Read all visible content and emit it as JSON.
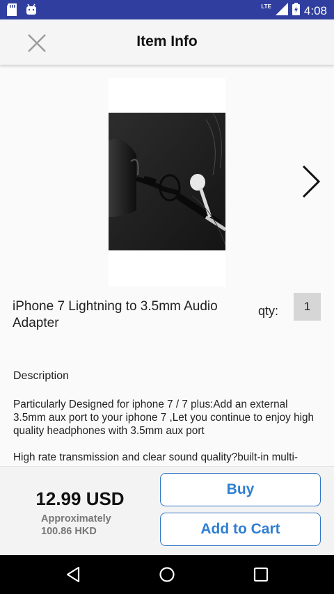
{
  "status_bar": {
    "time": "4:08",
    "network": "LTE",
    "icons": [
      "sd-card-icon",
      "android-icon",
      "signal-icon",
      "battery-icon"
    ]
  },
  "toolbar": {
    "title": "Item Info",
    "close_icon": "close-icon"
  },
  "product": {
    "name": "iPhone 7 Lightning to 3.5mm Audio Adapter",
    "qty_label": "qty:",
    "qty_value": "1",
    "next_icon": "chevron-right-icon"
  },
  "description": {
    "heading": "Description",
    "paragraph1": "Particularly Designed for iphone 7 / 7 plus:Add an external 3.5mm aux port to your iphone 7 ,Let you continue to enjoy high quality headphones with 3.5mm aux port",
    "paragraph2": "High rate transmission and clear sound quality?built-in multi-"
  },
  "purchase": {
    "price": "12.99 USD",
    "approx_line1": "Approximately",
    "approx_line2": "100.86 HKD",
    "buy_label": "Buy",
    "add_to_cart_label": "Add to Cart"
  },
  "colors": {
    "status_bar": "#303f9f",
    "button_text": "#2f7fd2",
    "button_border": "#2f74c7"
  },
  "nav_bar": {
    "icons": [
      "back-icon",
      "home-icon",
      "recents-icon"
    ]
  }
}
